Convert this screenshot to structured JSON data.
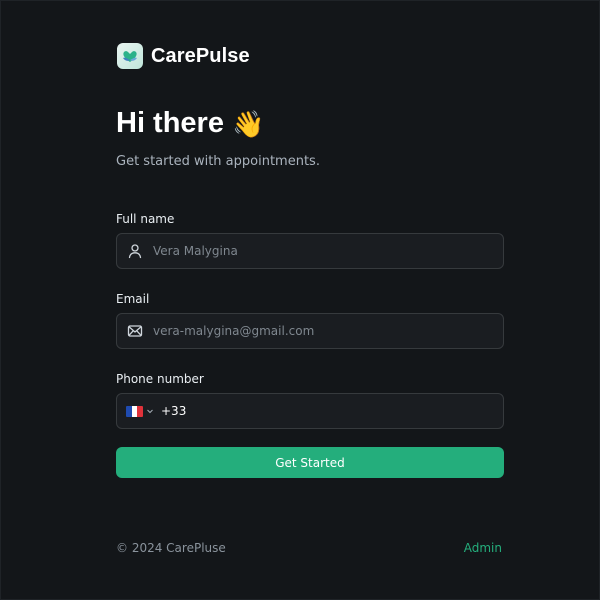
{
  "brand": {
    "name": "CarePulse",
    "logo_icon": "heart-hands-icon"
  },
  "hero": {
    "title": "Hi there",
    "emoji": "👋",
    "subtitle": "Get started with appointments."
  },
  "form": {
    "full_name": {
      "label": "Full name",
      "placeholder": "Vera Malygina",
      "icon": "user-icon"
    },
    "email": {
      "label": "Email",
      "placeholder": "vera-malygina@gmail.com",
      "icon": "mail-icon"
    },
    "phone": {
      "label": "Phone number",
      "country": "FR",
      "dial_code": "+33",
      "icon": "chevron-down-icon"
    },
    "submit_label": "Get Started"
  },
  "footer": {
    "copyright": "© 2024 CarePluse",
    "admin_link": "Admin"
  },
  "colors": {
    "background": "#131619",
    "input_bg": "#1a1d21",
    "accent": "#24ae7c",
    "muted_text": "#aab3bd"
  }
}
